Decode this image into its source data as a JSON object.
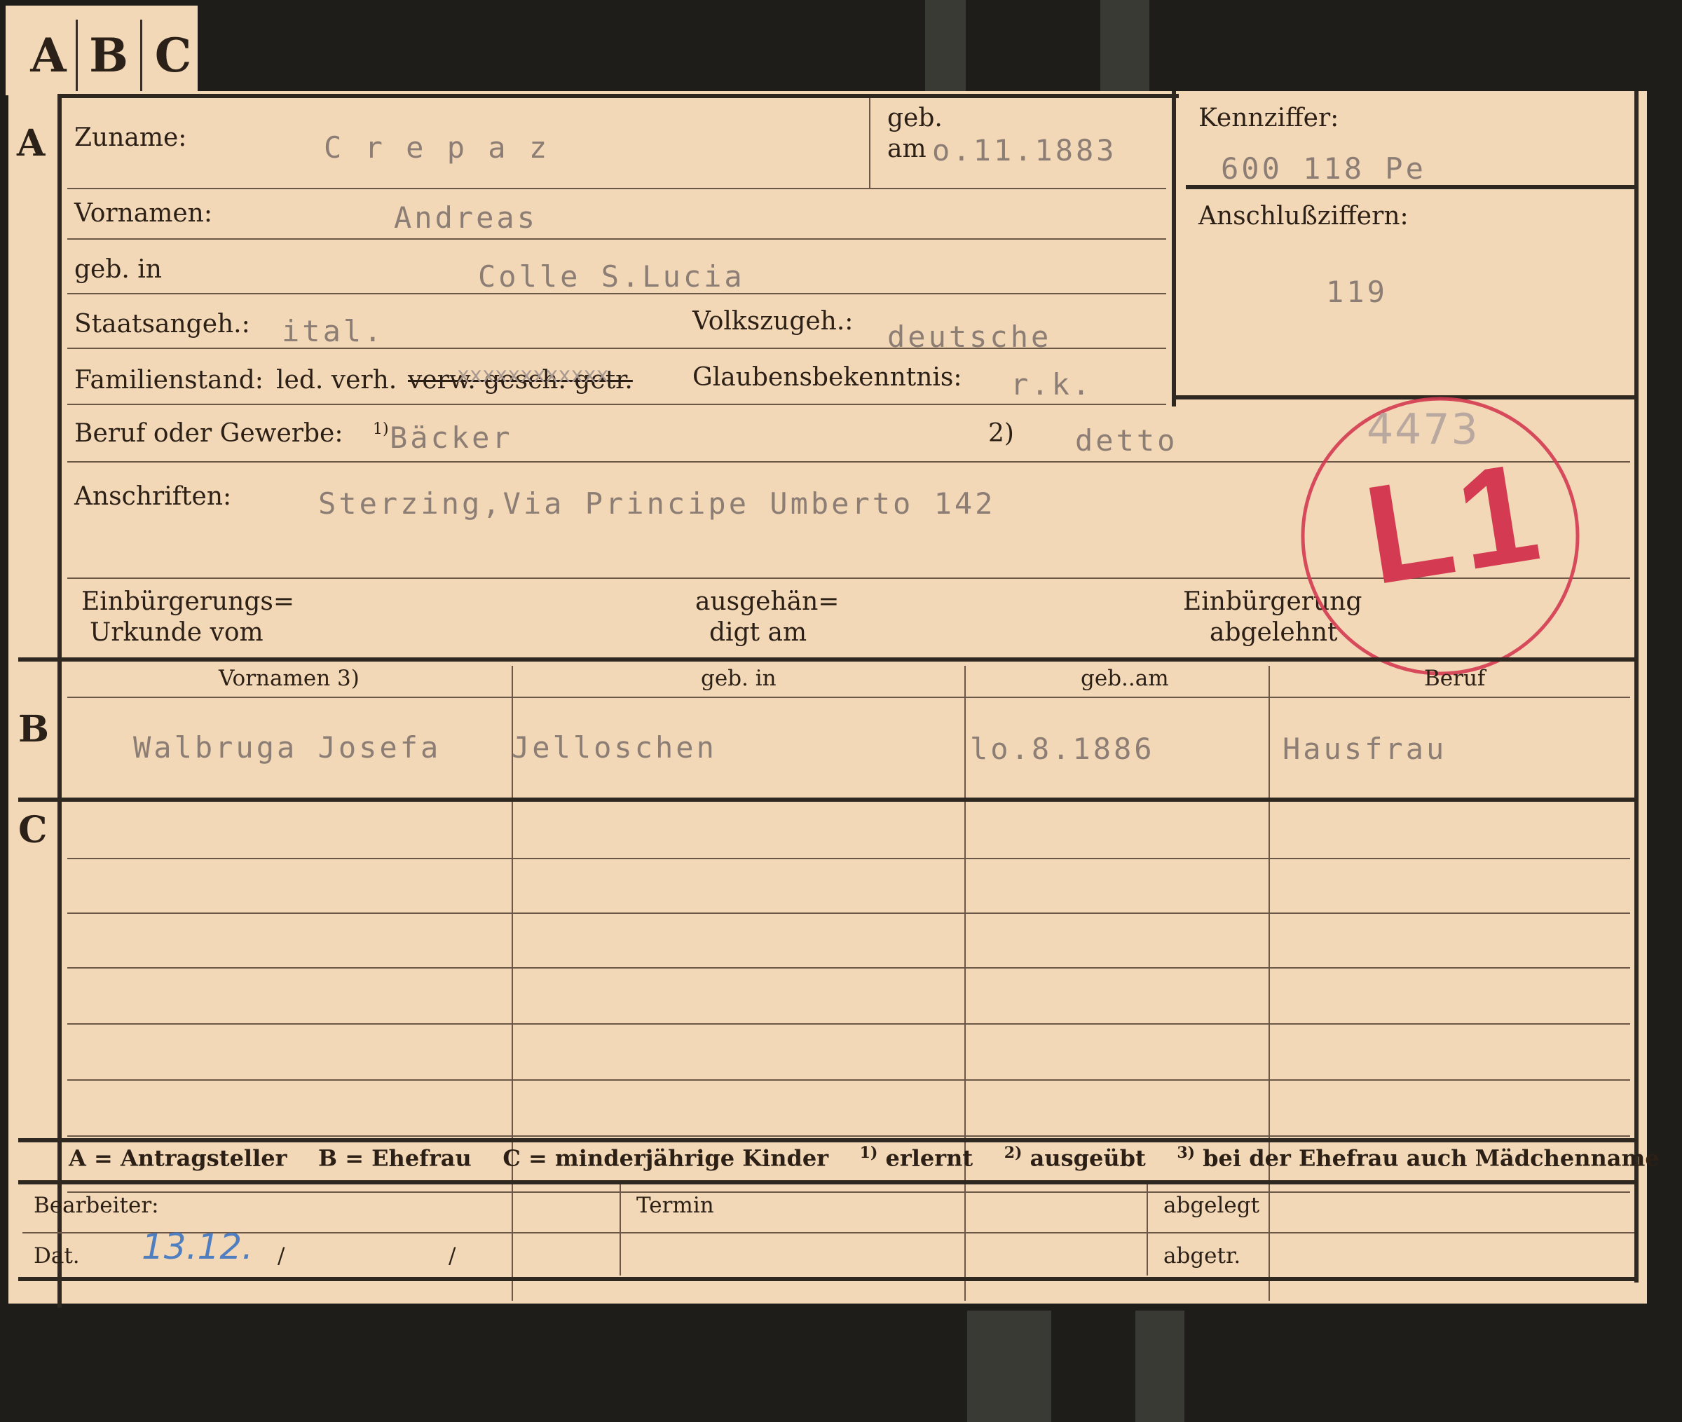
{
  "tabs": [
    "A",
    "B",
    "C"
  ],
  "sections": {
    "a": "A",
    "b": "B",
    "c": "C"
  },
  "labels": {
    "zuname": "Zuname:",
    "geb": "geb.",
    "am": "am",
    "kennziffer": "Kennziffer:",
    "vornamen": "Vornamen:",
    "anschlussziffern": "Anschlußziffern:",
    "geb_in": "geb. in",
    "staatsangeh": "Staatsangeh.:",
    "volkszugeh": "Volkszugeh.:",
    "familienstand": "Familienstand:",
    "familienstand_options_plain": "led. verh.",
    "familienstand_options_struck": "verw. gesch. getr.",
    "glaubensbekenntnis": "Glaubensbekenntnis:",
    "beruf": "Beruf oder Gewerbe:",
    "beruf_note2": "2)",
    "anschriften": "Anschriften:",
    "einbuergerung_urkunde_1": "Einbürgerungs=",
    "einbuergerung_urkunde_2": "Urkunde vom",
    "ausgehaendigt_1": "ausgehän=",
    "ausgehaendigt_2": "digt am",
    "einbuergerung_abgelehnt_1": "Einbürgerung",
    "einbuergerung_abgelehnt_2": "abgelehnt",
    "col_vornamen": "Vornamen 3)",
    "col_geb_in": "geb. in",
    "col_geb_am": "geb..am",
    "col_beruf": "Beruf",
    "bearbeiter": "Bearbeiter:",
    "dat": "Dat.",
    "termin": "Termin",
    "abgelegt": "abgelegt",
    "abgetr": "abgetr."
  },
  "applicant": {
    "zuname": "C r e p a z",
    "geb_am": "o.11.1883",
    "kennziffer": "600 118  Pe",
    "vornamen": "Andreas",
    "anschlussziffern": "119",
    "geb_in": "Colle S.Lucia",
    "staatsangeh": "ital.",
    "volkszugeh": "deutsche",
    "familienstand_overtype": "xxxxxxxxxxxx",
    "glaubensbekenntnis": "r.k.",
    "beruf_erlernt": "Bäcker",
    "beruf_ausgeuebt": "detto",
    "anschrift": "Sterzing,Via Principe Umberto  142"
  },
  "spouse": {
    "vornamen": "Walbruga Josefa",
    "geb_in": "Jelloschen",
    "geb_am": "lo.8.1886",
    "beruf": "Hausfrau"
  },
  "stamp": {
    "code": "L1",
    "number": "4473",
    "color": "#d43b52"
  },
  "handwritten_date": "13.12.",
  "date_separators": [
    "/",
    "/"
  ],
  "footer_legend": {
    "a": "A = Antragsteller",
    "b": "B = Ehefrau",
    "c": "C = minderjährige Kinder",
    "n1": "erlernt",
    "n2": "ausgeübt",
    "n3": "bei der Ehefrau auch Mädchenname"
  }
}
